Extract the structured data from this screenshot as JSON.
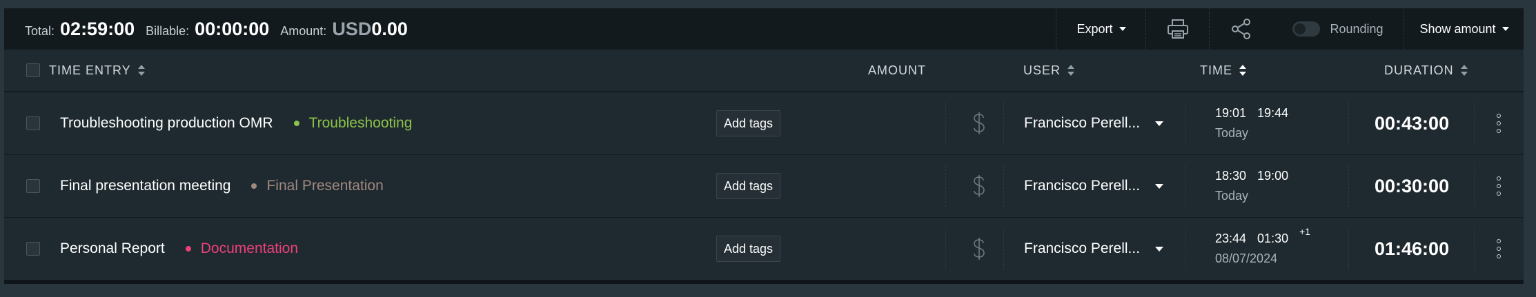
{
  "summary": {
    "total_label": "Total:",
    "total_value": "02:59:00",
    "billable_label": "Billable:",
    "billable_value": "00:00:00",
    "amount_label": "Amount:",
    "amount_currency": "USD",
    "amount_value": "0.00"
  },
  "toolbar": {
    "export_label": "Export",
    "print_icon": "printer-icon",
    "share_icon": "share-icon",
    "rounding_label": "Rounding",
    "rounding_on": false,
    "show_amount_label": "Show amount"
  },
  "columns": {
    "time_entry": "TIME ENTRY",
    "amount": "AMOUNT",
    "user": "USER",
    "time": "TIME",
    "duration": "DURATION"
  },
  "entries": [
    {
      "description": "Troubleshooting production OMR",
      "project": "Troubleshooting",
      "project_color": "#8bc34a",
      "tags_label": "Add tags",
      "billable_icon": "dollar-icon",
      "user": "Francisco Perell...",
      "start": "19:01",
      "end": "19:44",
      "day_offset": "",
      "date": "Today",
      "duration": "00:43:00"
    },
    {
      "description": "Final presentation meeting",
      "project": "Final Presentation",
      "project_color": "#a1887f",
      "tags_label": "Add tags",
      "billable_icon": "dollar-icon",
      "user": "Francisco Perell...",
      "start": "18:30",
      "end": "19:00",
      "day_offset": "",
      "date": "Today",
      "duration": "00:30:00"
    },
    {
      "description": "Personal Report",
      "project": "Documentation",
      "project_color": "#ec407a",
      "tags_label": "Add tags",
      "billable_icon": "dollar-icon",
      "user": "Francisco Perell...",
      "start": "23:44",
      "end": "01:30",
      "day_offset": "+1",
      "date": "08/07/2024",
      "duration": "01:46:00"
    }
  ]
}
